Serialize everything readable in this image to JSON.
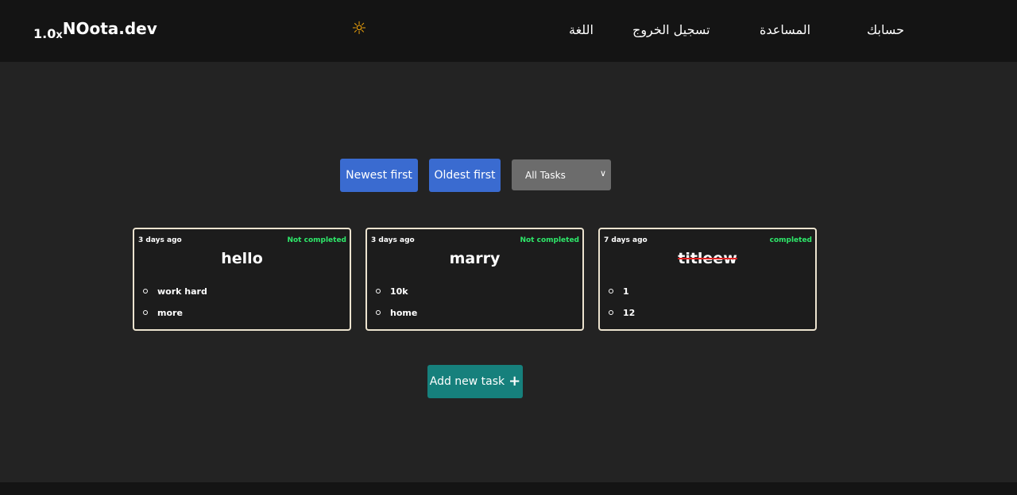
{
  "header": {
    "brand_version": "1.0",
    "brand_x": "x",
    "brand_name": "NOota.dev",
    "theme_icon": "sun-icon",
    "links": {
      "language": "اللغة",
      "logout": "تسجيل الخروج",
      "help": "المساعدة",
      "account": "حسابك"
    }
  },
  "toolbar": {
    "newest_label": "Newest first",
    "oldest_label": "Oldest first",
    "filter_value": "All Tasks"
  },
  "tasks": [
    {
      "age": "3 days ago",
      "status": "Not completed",
      "title": "hello",
      "items": [
        "work hard",
        "more"
      ]
    },
    {
      "age": "3 days ago",
      "status": "Not completed",
      "title": "marry",
      "items": [
        "10k",
        "home"
      ]
    },
    {
      "age": "7 days ago",
      "status": "completed",
      "title": "titleew",
      "items": [
        "1",
        "12"
      ]
    }
  ],
  "add_task_label": "Add new task",
  "colors": {
    "primary": "#3a6bd0",
    "add_button": "#16807c",
    "status": "#2ee86a",
    "strike": "#e02222"
  }
}
